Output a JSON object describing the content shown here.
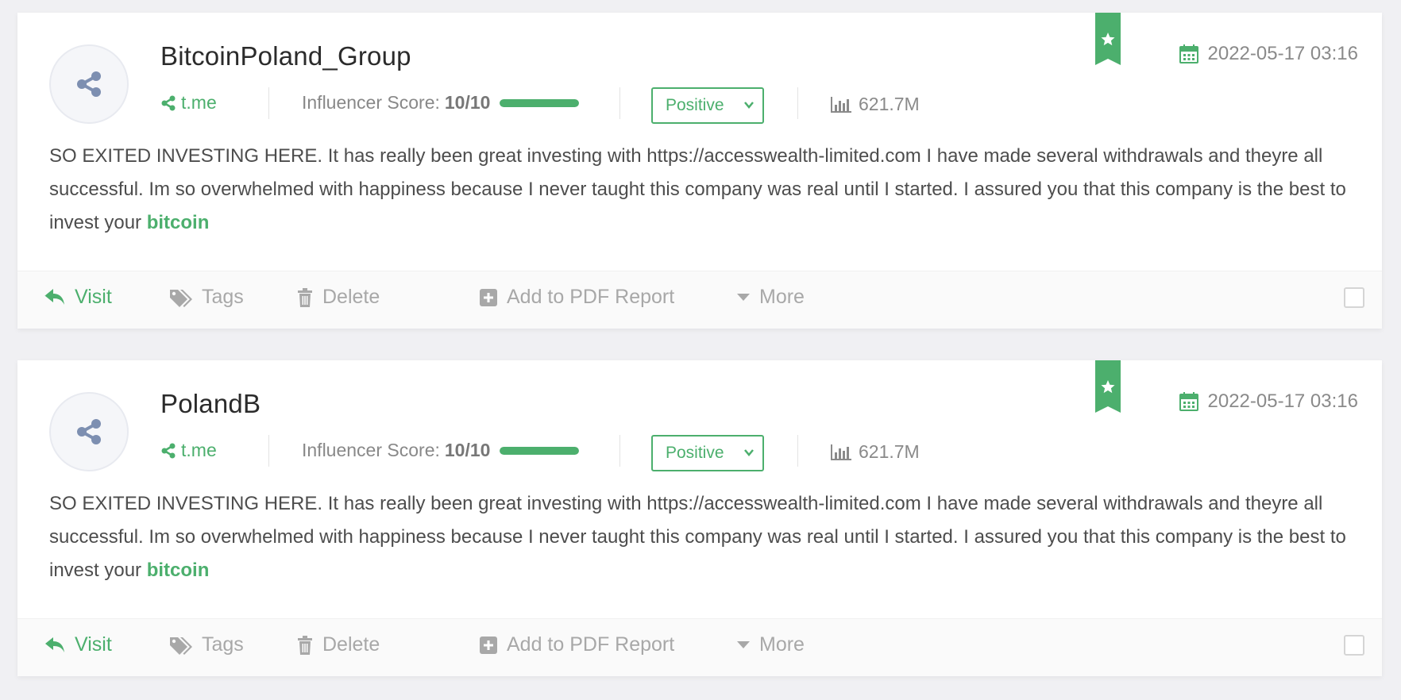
{
  "colors": {
    "accent": "#4caf6d",
    "muted": "#a8a8a8",
    "background": "#f0f0f3",
    "avatar_icon": "#7d8fb1"
  },
  "mentions": [
    {
      "title": "BitcoinPoland_Group",
      "avatar_icon": "share-icon",
      "source": "t.me",
      "influencer_score_label": "Influencer Score:",
      "influencer_score": "10/10",
      "influencer_score_value": 1.0,
      "sentiment": "Positive",
      "reach": "621.7M",
      "date": "2022-05-17 03:16",
      "text": "SO EXITED INVESTING HERE. It has really been great investing with https://accesswealth-limited.com I have made several withdrawals and theyre all successful. Im so overwhelmed with happiness because I never taught this company was real until I started. I assured you that this company is the best to invest your ",
      "keyword": "bitcoin",
      "actions": {
        "visit": "Visit",
        "tags": "Tags",
        "delete": "Delete",
        "pdf": "Add to PDF Report",
        "more": "More"
      }
    },
    {
      "title": "PolandB",
      "avatar_icon": "share-icon",
      "source": "t.me",
      "influencer_score_label": "Influencer Score:",
      "influencer_score": "10/10",
      "influencer_score_value": 1.0,
      "sentiment": "Positive",
      "reach": "621.7M",
      "date": "2022-05-17 03:16",
      "text": "SO EXITED INVESTING HERE. It has really been great investing with https://accesswealth-limited.com I have made several withdrawals and theyre all successful. Im so overwhelmed with happiness because I never taught this company was real until I started. I assured you that this company is the best to invest your ",
      "keyword": "bitcoin",
      "actions": {
        "visit": "Visit",
        "tags": "Tags",
        "delete": "Delete",
        "pdf": "Add to PDF Report",
        "more": "More"
      }
    }
  ]
}
